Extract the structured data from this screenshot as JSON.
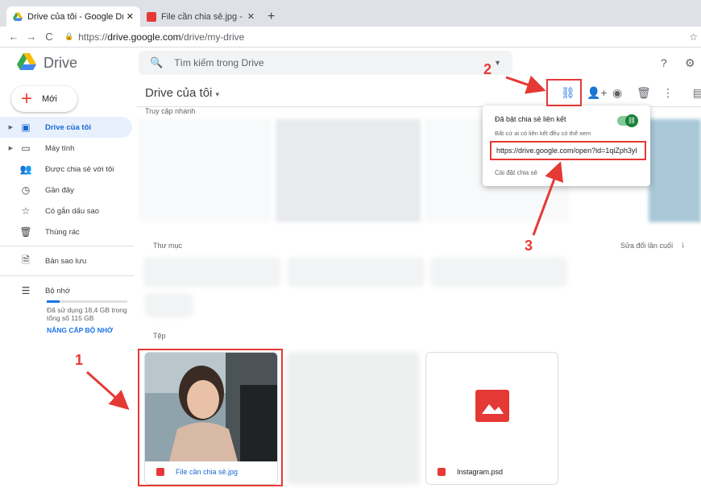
{
  "browser": {
    "tabs": [
      {
        "title": "Drive của tôi - Google Drive",
        "icon": "google-drive-icon"
      },
      {
        "title": "File cần chia sẻ.jpg - Google Dri…",
        "icon": "image-file-icon"
      }
    ],
    "url_prefix": "https://",
    "url_host": "drive.google.com",
    "url_path": "/drive/my-drive"
  },
  "header": {
    "brand": "Drive",
    "search_placeholder": "Tìm kiếm trong Drive"
  },
  "toolbar": {
    "title": "Drive của tôi"
  },
  "sidebar": {
    "new_label": "Mới",
    "items": [
      {
        "label": "Drive của tôi",
        "icon": "my-drive-icon",
        "selected": true
      },
      {
        "label": "Máy tính",
        "icon": "computer-icon"
      },
      {
        "label": "Được chia sẻ với tôi",
        "icon": "shared-icon"
      },
      {
        "label": "Gần đây",
        "icon": "clock-icon"
      },
      {
        "label": "Có gắn dấu sao",
        "icon": "star-icon"
      },
      {
        "label": "Thùng rác",
        "icon": "trash-icon"
      },
      {
        "label": "Bản sao lưu",
        "icon": "backup-icon"
      },
      {
        "label": "Bộ nhớ",
        "icon": "storage-icon"
      }
    ],
    "storage_used_text": "Đã sử dụng 18,4 GB trong tổng số 115 GB",
    "storage_fraction": 0.16,
    "upgrade_label": "NÂNG CẤP BỘ NHỚ"
  },
  "main": {
    "quick_access_label": "Truy cập nhanh",
    "folders_label": "Thư mục",
    "sort_label": "Sửa đổi lần cuối",
    "files_label": "Tệp",
    "files": [
      {
        "name": "File cần chia sẻ.jpg"
      },
      {
        "name": "Instagram.psd"
      }
    ]
  },
  "share_popup": {
    "title": "Đã bật chia sẻ liên kết",
    "subtitle": "Bất cứ ai có liên kết đều có thể xem",
    "link": "https://drive.google.com/open?id=1qiZph3yI",
    "settings_label": "Cài đặt chia sẻ"
  },
  "annotations": {
    "step1": "1",
    "step2": "2",
    "step3": "3"
  },
  "colors": {
    "accent_blue": "#1a73e8",
    "annotation_red": "#e53935",
    "toggle_green": "#188038"
  }
}
